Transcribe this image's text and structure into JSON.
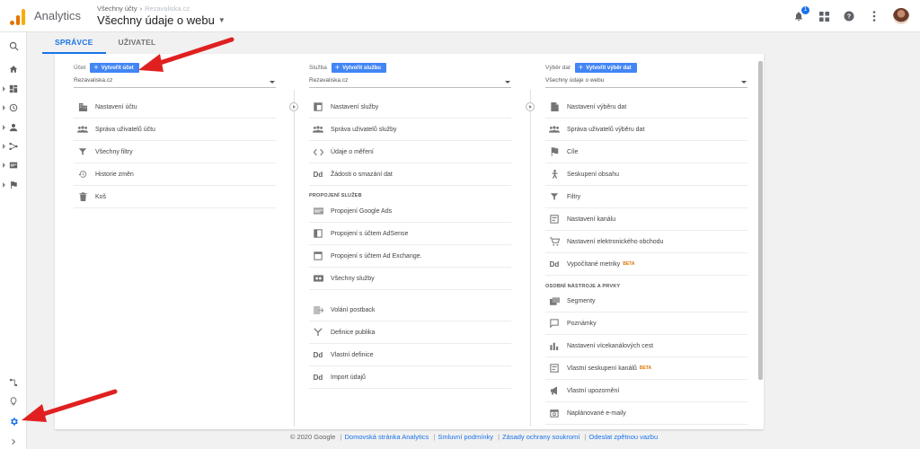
{
  "header": {
    "app_name": "Analytics",
    "breadcrumb_top": "Všechny účty",
    "breadcrumb_account": "Rezavaliska.cz",
    "view_title": "Všechny údaje o webu",
    "notification_count": "1"
  },
  "tabs": [
    {
      "label": "SPRÁVCE",
      "active": true
    },
    {
      "label": "UŽIVATEL",
      "active": false
    }
  ],
  "account_col": {
    "label": "Účet",
    "create_label": "Vytvořit účet",
    "selected": "Rezavaliska.cz",
    "items": [
      {
        "label": "Nastavení účtu",
        "icon": "building-icon"
      },
      {
        "label": "Správa uživatelů účtu",
        "icon": "users-icon"
      },
      {
        "label": "Všechny filtry",
        "icon": "filter-icon"
      },
      {
        "label": "Historie změn",
        "icon": "history-icon"
      },
      {
        "label": "Koš",
        "icon": "trash-icon"
      }
    ]
  },
  "property_col": {
    "label": "Služba",
    "create_label": "Vytvořit službu",
    "selected": "Rezavaliska.cz",
    "items": [
      {
        "label": "Nastavení služby",
        "icon": "settings-box-icon"
      },
      {
        "label": "Správa uživatelů služby",
        "icon": "users-icon"
      },
      {
        "label": "Údaje o měření",
        "icon": "code-icon"
      },
      {
        "label": "Žádosti o smazání dat",
        "icon": "dd-icon"
      }
    ],
    "section_title": "PROPOJENÍ SLUŽEB",
    "links": [
      {
        "label": "Propojení Google Ads",
        "icon": "ads-icon"
      },
      {
        "label": "Propojení s účtem AdSense",
        "icon": "adsense-icon"
      },
      {
        "label": "Propojení s účtem Ad Exchange.",
        "icon": "adexchange-icon"
      },
      {
        "label": "Všechny služby",
        "icon": "all-products-icon"
      }
    ],
    "extra": [
      {
        "label": "Volání postback",
        "icon": "postback-icon"
      },
      {
        "label": "Definice publika",
        "icon": "audience-icon"
      },
      {
        "label": "Vlastní definice",
        "icon": "dd-icon"
      },
      {
        "label": "Import údajů",
        "icon": "dd-icon"
      }
    ]
  },
  "view_col": {
    "label": "Výběr dat",
    "create_label": "Vytvořit výběr dat",
    "selected": "Všechny údaje o webu",
    "items": [
      {
        "label": "Nastavení výběru dat",
        "icon": "document-icon",
        "beta": ""
      },
      {
        "label": "Správa uživatelů výběru dat",
        "icon": "users-icon",
        "beta": ""
      },
      {
        "label": "Cíle",
        "icon": "flag-icon",
        "beta": ""
      },
      {
        "label": "Seskupení obsahu",
        "icon": "person-walk-icon",
        "beta": ""
      },
      {
        "label": "Filtry",
        "icon": "filter-icon",
        "beta": ""
      },
      {
        "label": "Nastavení kanálu",
        "icon": "channel-icon",
        "beta": ""
      },
      {
        "label": "Nastavení elektronického obchodu",
        "icon": "cart-icon",
        "beta": ""
      },
      {
        "label": "Vypočítané metriky",
        "icon": "dd-icon",
        "beta": "BETA"
      }
    ],
    "section_title": "OSOBNÍ NÁSTROJE A PRVKY",
    "tools": [
      {
        "label": "Segmenty",
        "icon": "segments-icon",
        "beta": ""
      },
      {
        "label": "Poznámky",
        "icon": "notes-icon",
        "beta": ""
      },
      {
        "label": "Nastavení vícekanálových cest",
        "icon": "bars-icon",
        "beta": ""
      },
      {
        "label": "Vlastní seskupení kanálů",
        "icon": "channel-icon",
        "beta": "BETA"
      },
      {
        "label": "Vlastní upozornění",
        "icon": "megaphone-icon",
        "beta": ""
      },
      {
        "label": "Naplánované e-maily",
        "icon": "schedule-icon",
        "beta": ""
      }
    ]
  },
  "footer": {
    "copyright": "© 2020 Google",
    "links": [
      "Domovská stránka Analytics",
      "Smluvní podmínky",
      "Zásady ochrany soukromí",
      "Odeslat zpětnou vazbu"
    ]
  }
}
